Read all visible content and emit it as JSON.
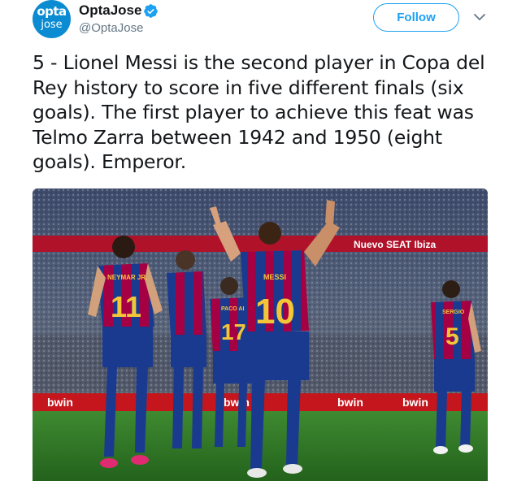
{
  "account": {
    "avatar_line1": "opta",
    "avatar_line2": "jose",
    "display_name": "OptaJose",
    "handle": "@OptaJose",
    "verified_icon": "verified-badge-icon"
  },
  "actions": {
    "follow_label": "Follow",
    "more_icon": "chevron-down-icon"
  },
  "tweet": {
    "text": "5 - Lionel Messi is the second player in Copa del Rey history to score in five different finals (six goals). The first player to achieve this feat was Telmo Zarra between 1942 and 1950 (eight goals). Emperor."
  },
  "media": {
    "jerseys": [
      {
        "name": "NEYMAR JR.",
        "number": "11"
      },
      {
        "name": "PACO AL.",
        "number": "17"
      },
      {
        "name": "MESSI",
        "number": "10"
      },
      {
        "name": "SERGIO",
        "number": "5"
      }
    ],
    "ad_board_text": "Nuevo SEAT Ibiza",
    "pitch_boards": [
      "bwin",
      "bwin",
      "bwin",
      "bwin"
    ]
  },
  "colors": {
    "accent": "#1da1f2",
    "barca_blue": "#1a3a8f",
    "barca_red": "#a50044",
    "pitch": "#2f7a2a"
  }
}
